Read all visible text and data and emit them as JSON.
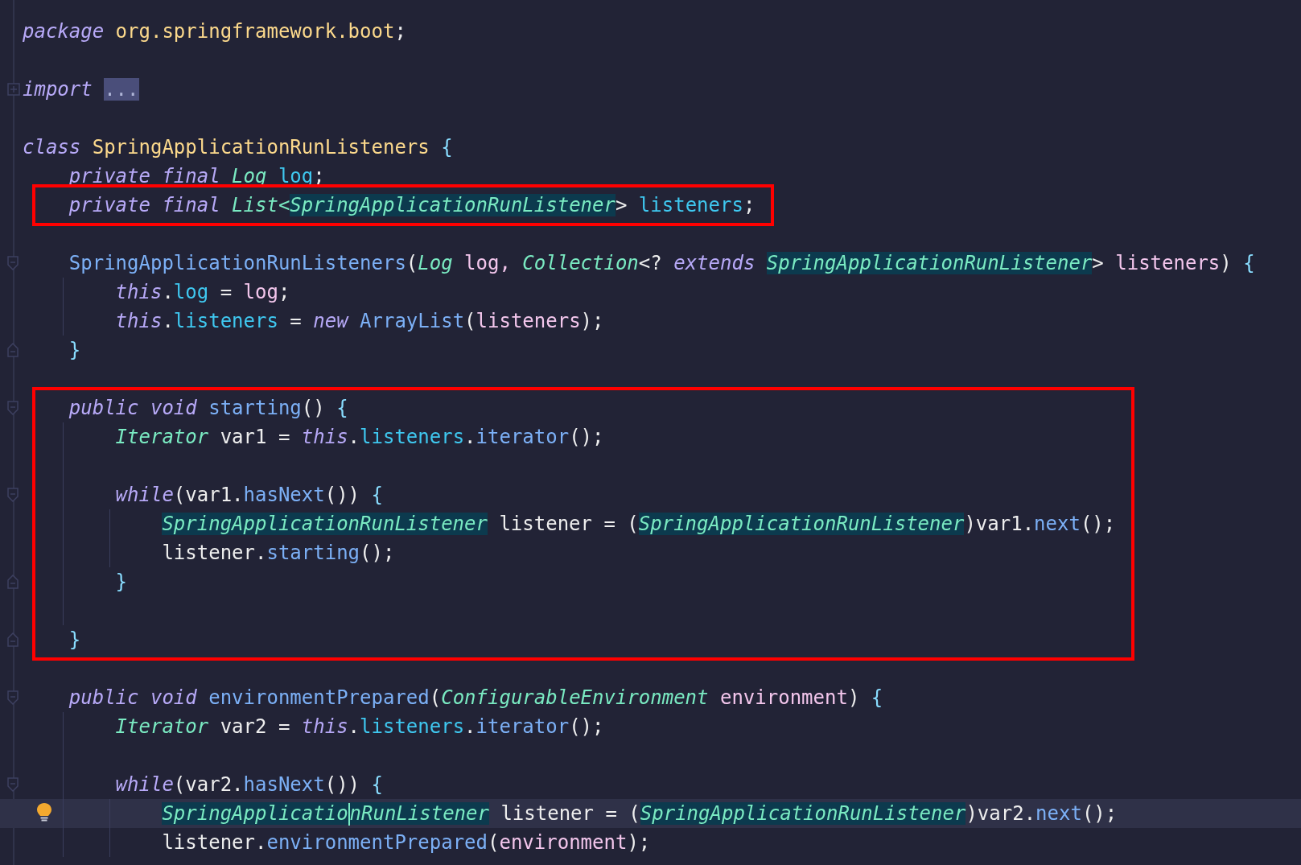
{
  "code": [
    {
      "kind": "line",
      "tokens": [
        {
          "t": "package ",
          "kind": "kw"
        },
        {
          "t": "org.springframework.boot",
          "kind": "pkg"
        },
        {
          "t": ";",
          "kind": "plain"
        }
      ],
      "foldable": false,
      "framed": false,
      "current": false,
      "bulb": false
    },
    {
      "kind": "blank",
      "framed": false,
      "current": false,
      "bulb": false
    },
    {
      "kind": "line",
      "tokens": [
        {
          "t": "import ",
          "kind": "kw"
        },
        {
          "t": "...",
          "kind": "fold"
        }
      ],
      "foldable": false,
      "framed": false,
      "current": false,
      "bulb": false
    },
    {
      "kind": "blank",
      "framed": false,
      "current": false,
      "bulb": false
    },
    {
      "kind": "line",
      "tokens": [
        {
          "t": "class ",
          "kind": "kw"
        },
        {
          "t": "SpringApplicationRunListeners ",
          "kind": "pkg"
        },
        {
          "t": "{",
          "kind": "brace"
        }
      ],
      "foldable": false,
      "framed": false,
      "current": false,
      "bulb": false,
      "children": [
        {
          "kind": "line",
          "tokens": [
            {
              "t": "private final ",
              "kind": "kw"
            },
            {
              "t": "Log ",
              "kind": "type"
            },
            {
              "t": "log",
              "kind": "field"
            },
            {
              "t": ";",
              "kind": "plain"
            }
          ],
          "foldable": false,
          "framed": false,
          "current": false,
          "bulb": false
        },
        {
          "kind": "line",
          "tokens": [
            {
              "t": "private final ",
              "kind": "kw"
            },
            {
              "t": "List<",
              "kind": "type"
            },
            {
              "t": "SpringApplicationRunListener",
              "kind": "typehl"
            },
            {
              "t": "> ",
              "kind": "plain"
            },
            {
              "t": "listeners",
              "kind": "field"
            },
            {
              "t": ";",
              "kind": "plain"
            }
          ],
          "foldable": false,
          "framed": true,
          "current": false,
          "bulb": false
        },
        {
          "kind": "blank",
          "framed": false,
          "current": false,
          "bulb": false
        },
        {
          "kind": "line",
          "tokens": [
            {
              "t": "SpringApplicationRunListeners",
              "kind": "method"
            },
            {
              "t": "(",
              "kind": "plain"
            },
            {
              "t": "Log ",
              "kind": "type"
            },
            {
              "t": "log, ",
              "kind": "param"
            },
            {
              "t": "Collection",
              "kind": "type"
            },
            {
              "t": "<? ",
              "kind": "plain"
            },
            {
              "t": "extends ",
              "kind": "kw"
            },
            {
              "t": "SpringApplicationRunListener",
              "kind": "typehl"
            },
            {
              "t": "> ",
              "kind": "plain"
            },
            {
              "t": "listeners",
              "kind": "param"
            },
            {
              "t": ") ",
              "kind": "plain"
            },
            {
              "t": "{",
              "kind": "brace"
            }
          ],
          "foldable": true,
          "framed": false,
          "current": false,
          "bulb": false,
          "children": [
            {
              "kind": "line",
              "tokens": [
                {
                  "t": "this",
                  "kind": "kw"
                },
                {
                  "t": ".",
                  "kind": "plain"
                },
                {
                  "t": "log",
                  "kind": "field"
                },
                {
                  "t": " = ",
                  "kind": "plain"
                },
                {
                  "t": "log",
                  "kind": "param"
                },
                {
                  "t": ";",
                  "kind": "plain"
                }
              ],
              "foldable": false,
              "framed": false,
              "current": false,
              "bulb": false
            },
            {
              "kind": "line",
              "tokens": [
                {
                  "t": "this",
                  "kind": "kw"
                },
                {
                  "t": ".",
                  "kind": "plain"
                },
                {
                  "t": "listeners",
                  "kind": "field"
                },
                {
                  "t": " = ",
                  "kind": "plain"
                },
                {
                  "t": "new ",
                  "kind": "kw"
                },
                {
                  "t": "ArrayList",
                  "kind": "method"
                },
                {
                  "t": "(",
                  "kind": "plain"
                },
                {
                  "t": "listeners",
                  "kind": "param"
                },
                {
                  "t": ");",
                  "kind": "plain"
                }
              ],
              "foldable": false,
              "framed": false,
              "current": false,
              "bulb": false
            }
          ],
          "closing": [
            {
              "t": "}",
              "kind": "brace"
            }
          ]
        },
        {
          "kind": "blank",
          "framed": false,
          "current": false,
          "bulb": false
        },
        {
          "kind": "line",
          "tokens": [
            {
              "t": "public void ",
              "kind": "kw"
            },
            {
              "t": "starting",
              "kind": "method"
            },
            {
              "t": "() ",
              "kind": "plain"
            },
            {
              "t": "{",
              "kind": "brace"
            }
          ],
          "foldable": true,
          "framed": true,
          "current": false,
          "bulb": false,
          "children": [
            {
              "kind": "line",
              "tokens": [
                {
                  "t": "Iterator",
                  "kind": "type"
                },
                {
                  "t": " var1 = ",
                  "kind": "plain"
                },
                {
                  "t": "this",
                  "kind": "kw"
                },
                {
                  "t": ".",
                  "kind": "plain"
                },
                {
                  "t": "listeners",
                  "kind": "field"
                },
                {
                  "t": ".",
                  "kind": "plain"
                },
                {
                  "t": "iterator",
                  "kind": "method"
                },
                {
                  "t": "();",
                  "kind": "plain"
                }
              ],
              "foldable": false,
              "framed": false,
              "current": false,
              "bulb": false
            },
            {
              "kind": "blank",
              "framed": false,
              "current": false,
              "bulb": false
            },
            {
              "kind": "line",
              "tokens": [
                {
                  "t": "while",
                  "kind": "kw"
                },
                {
                  "t": "(var1.",
                  "kind": "plain"
                },
                {
                  "t": "hasNext",
                  "kind": "method"
                },
                {
                  "t": "()) ",
                  "kind": "plain"
                },
                {
                  "t": "{",
                  "kind": "brace"
                }
              ],
              "foldable": true,
              "framed": false,
              "current": false,
              "bulb": false,
              "children": [
                {
                  "kind": "line",
                  "tokens": [
                    {
                      "t": "SpringApplicationRunListener",
                      "kind": "typehl"
                    },
                    {
                      "t": " listener = (",
                      "kind": "plain"
                    },
                    {
                      "t": "SpringApplicationRunListener",
                      "kind": "typehl"
                    },
                    {
                      "t": ")var1.",
                      "kind": "plain"
                    },
                    {
                      "t": "next",
                      "kind": "method"
                    },
                    {
                      "t": "();",
                      "kind": "plain"
                    }
                  ],
                  "foldable": false,
                  "framed": false,
                  "current": false,
                  "bulb": false
                },
                {
                  "kind": "line",
                  "tokens": [
                    {
                      "t": "listener.",
                      "kind": "plain"
                    },
                    {
                      "t": "starting",
                      "kind": "method"
                    },
                    {
                      "t": "();",
                      "kind": "plain"
                    }
                  ],
                  "foldable": false,
                  "framed": false,
                  "current": false,
                  "bulb": false
                }
              ],
              "closing": [
                {
                  "t": "}",
                  "kind": "brace"
                }
              ]
            },
            {
              "kind": "blank",
              "framed": false,
              "current": false,
              "bulb": false
            }
          ],
          "closing": [
            {
              "t": "}",
              "kind": "brace"
            }
          ]
        },
        {
          "kind": "blank",
          "framed": false,
          "current": false,
          "bulb": false
        },
        {
          "kind": "line",
          "tokens": [
            {
              "t": "public void ",
              "kind": "kw"
            },
            {
              "t": "environmentPrepared",
              "kind": "method"
            },
            {
              "t": "(",
              "kind": "plain"
            },
            {
              "t": "ConfigurableEnvironment ",
              "kind": "type"
            },
            {
              "t": "environment",
              "kind": "param"
            },
            {
              "t": ") ",
              "kind": "plain"
            },
            {
              "t": "{",
              "kind": "brace"
            }
          ],
          "foldable": true,
          "framed": false,
          "current": false,
          "bulb": false,
          "children": [
            {
              "kind": "line",
              "tokens": [
                {
                  "t": "Iterator",
                  "kind": "type"
                },
                {
                  "t": " var2 = ",
                  "kind": "plain"
                },
                {
                  "t": "this",
                  "kind": "kw"
                },
                {
                  "t": ".",
                  "kind": "plain"
                },
                {
                  "t": "listeners",
                  "kind": "field"
                },
                {
                  "t": ".",
                  "kind": "plain"
                },
                {
                  "t": "iterator",
                  "kind": "method"
                },
                {
                  "t": "();",
                  "kind": "plain"
                }
              ],
              "foldable": false,
              "framed": false,
              "current": false,
              "bulb": false
            },
            {
              "kind": "blank",
              "framed": false,
              "current": false,
              "bulb": false
            },
            {
              "kind": "line",
              "tokens": [
                {
                  "t": "while",
                  "kind": "kw"
                },
                {
                  "t": "(var2.",
                  "kind": "plain"
                },
                {
                  "t": "hasNext",
                  "kind": "method"
                },
                {
                  "t": "()) ",
                  "kind": "plain"
                },
                {
                  "t": "{",
                  "kind": "brace"
                }
              ],
              "foldable": true,
              "framed": false,
              "current": false,
              "bulb": false,
              "children": [
                {
                  "kind": "line",
                  "tokens": [
                    {
                      "t": "SpringApplicatio",
                      "kind": "typehl",
                      "caret": true
                    },
                    {
                      "t": "nRunListener",
                      "kind": "typehl"
                    },
                    {
                      "t": " listener = (",
                      "kind": "plain"
                    },
                    {
                      "t": "SpringApplicationRunListener",
                      "kind": "typehl"
                    },
                    {
                      "t": ")var2.",
                      "kind": "plain"
                    },
                    {
                      "t": "next",
                      "kind": "method"
                    },
                    {
                      "t": "();",
                      "kind": "plain"
                    }
                  ],
                  "foldable": false,
                  "framed": false,
                  "current": true,
                  "bulb": true
                },
                {
                  "kind": "line",
                  "tokens": [
                    {
                      "t": "listener.",
                      "kind": "plain"
                    },
                    {
                      "t": "environmentPrepared",
                      "kind": "method"
                    },
                    {
                      "t": "(",
                      "kind": "plain"
                    },
                    {
                      "t": "environment",
                      "kind": "param"
                    },
                    {
                      "t": ");",
                      "kind": "plain"
                    }
                  ],
                  "foldable": false,
                  "framed": false,
                  "current": false,
                  "bulb": false
                }
              ]
            }
          ]
        }
      ]
    }
  ]
}
